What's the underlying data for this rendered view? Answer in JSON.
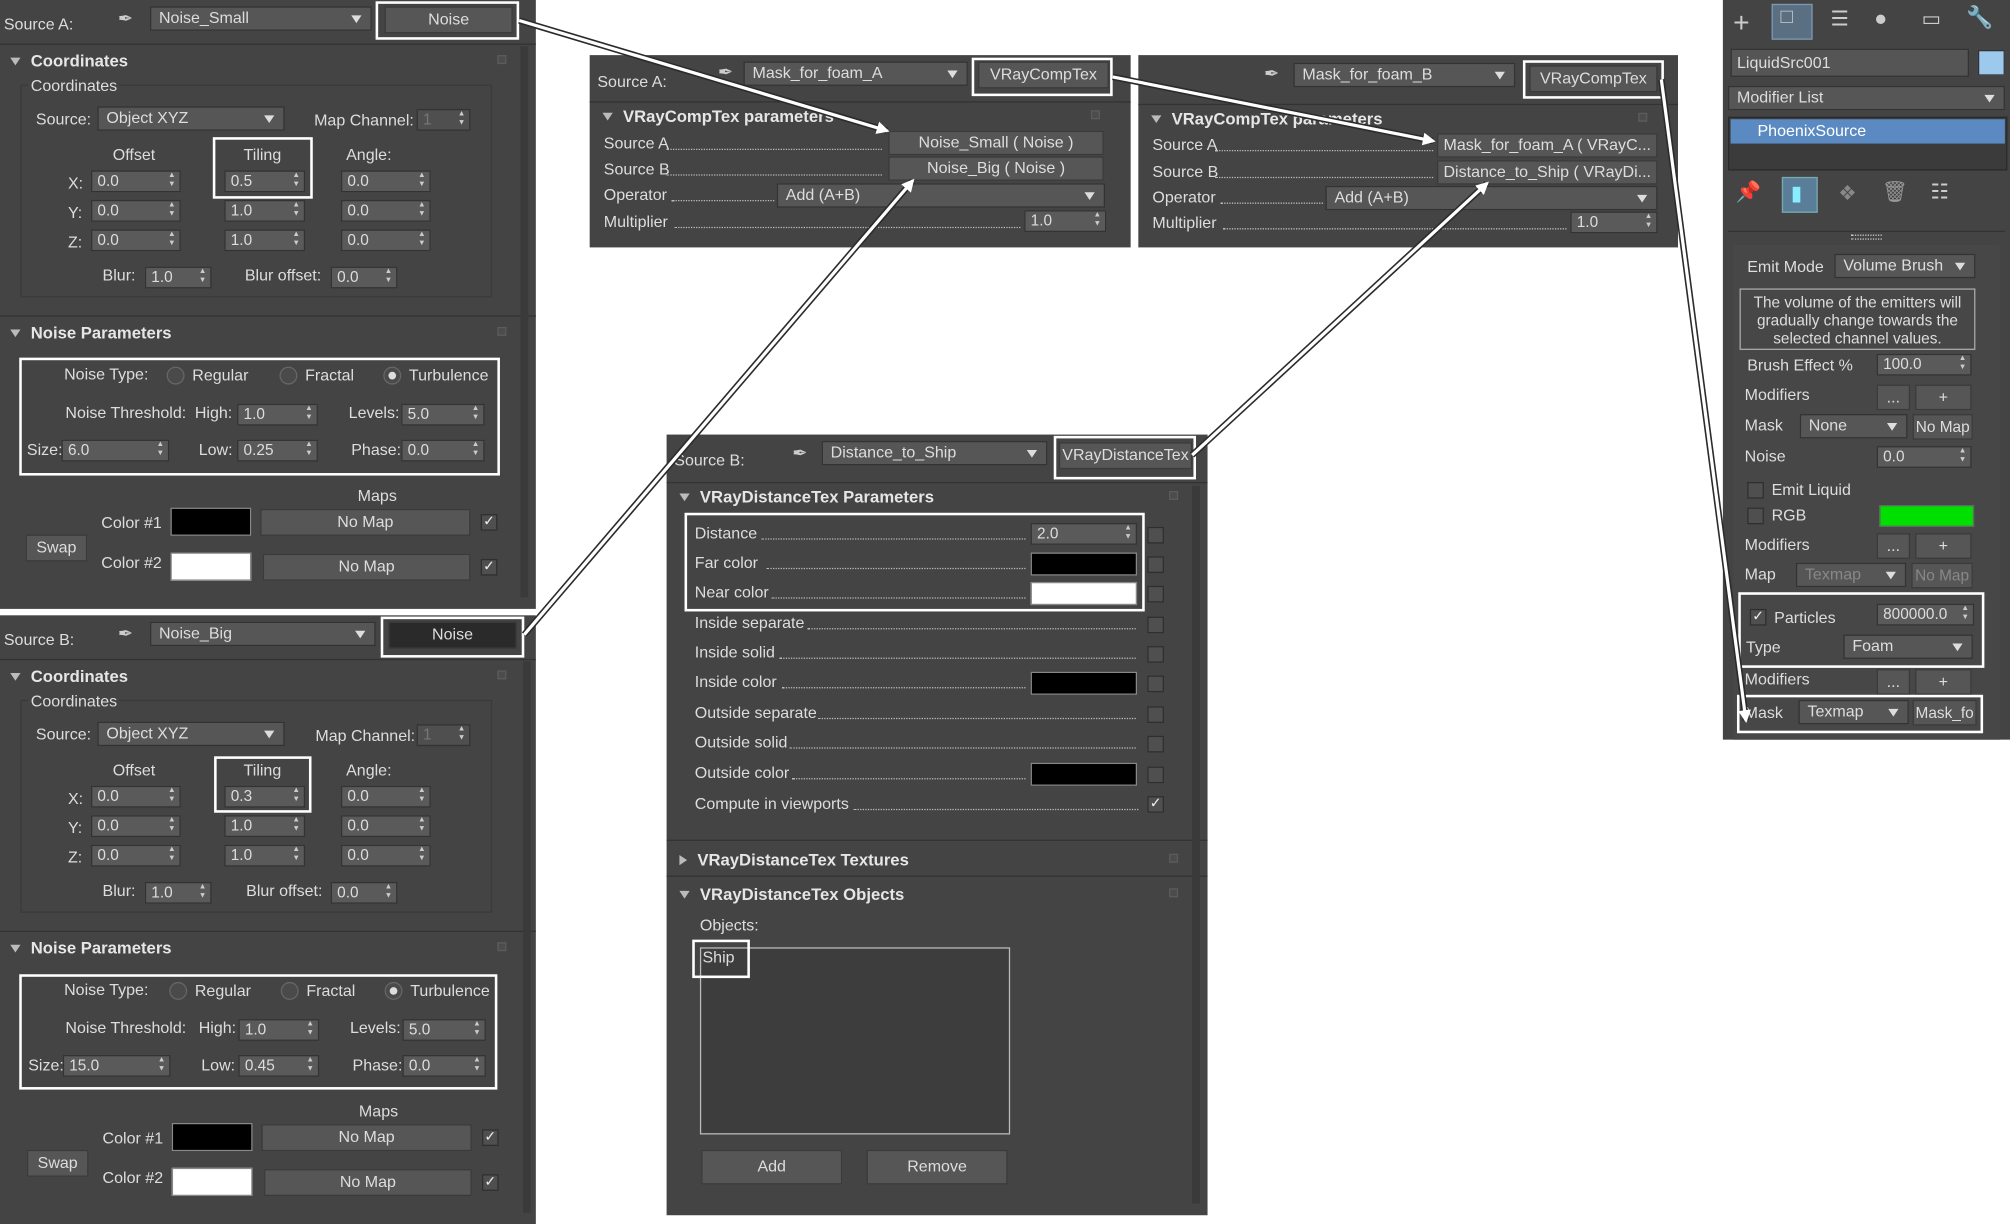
{
  "panelA": {
    "source_label": "Source A:",
    "map_name": "Noise_Small",
    "map_type": "Noise",
    "coords_header": "Coordinates",
    "coords_sub": "Coordinates",
    "source_label2": "Source:",
    "source_value": "Object XYZ",
    "map_channel_label": "Map Channel:",
    "map_channel_value": "1",
    "offset": "Offset",
    "tiling": "Tiling",
    "angle": "Angle:",
    "x": "X:",
    "y": "Y:",
    "z": "Z:",
    "ox": "0.0",
    "oy": "0.0",
    "oz": "0.0",
    "tx": "0.5",
    "ty": "1.0",
    "tz": "1.0",
    "ax": "0.0",
    "ay": "0.0",
    "az": "0.0",
    "blur": "Blur:",
    "blur_value": "1.0",
    "blur_offset": "Blur offset:",
    "blur_offset_value": "0.0",
    "noise_header": "Noise Parameters",
    "noise_type": "Noise Type:",
    "regular": "Regular",
    "fractal": "Fractal",
    "turbulence": "Turbulence",
    "threshold": "Noise Threshold:",
    "high": "High:",
    "high_value": "1.0",
    "levels": "Levels:",
    "levels_value": "5.0",
    "size": "Size:",
    "size_value": "6.0",
    "low": "Low:",
    "low_value": "0.25",
    "phase": "Phase:",
    "phase_value": "0.0",
    "maps": "Maps",
    "color1": "Color #1",
    "color2": "Color #2",
    "no_map": "No Map",
    "swap": "Swap"
  },
  "panelB": {
    "source_label": "Source B:",
    "map_name": "Noise_Big",
    "map_type": "Noise",
    "coords_header": "Coordinates",
    "coords_sub": "Coordinates",
    "source_label2": "Source:",
    "source_value": "Object XYZ",
    "map_channel_label": "Map Channel:",
    "map_channel_value": "1",
    "offset": "Offset",
    "tiling": "Tiling",
    "angle": "Angle:",
    "x": "X:",
    "y": "Y:",
    "z": "Z:",
    "ox": "0.0",
    "oy": "0.0",
    "oz": "0.0",
    "tx": "0.3",
    "ty": "1.0",
    "tz": "1.0",
    "ax": "0.0",
    "ay": "0.0",
    "az": "0.0",
    "blur": "Blur:",
    "blur_value": "1.0",
    "blur_offset": "Blur offset:",
    "blur_offset_value": "0.0",
    "noise_header": "Noise Parameters",
    "noise_type": "Noise Type:",
    "regular": "Regular",
    "fractal": "Fractal",
    "turbulence": "Turbulence",
    "threshold": "Noise Threshold:",
    "high": "High:",
    "high_value": "1.0",
    "levels": "Levels:",
    "levels_value": "5.0",
    "size": "Size:",
    "size_value": "15.0",
    "low": "Low:",
    "low_value": "0.45",
    "phase": "Phase:",
    "phase_value": "0.0",
    "maps": "Maps",
    "color1": "Color #1",
    "color2": "Color #2",
    "no_map": "No Map",
    "swap": "Swap"
  },
  "comp1": {
    "source_label": "Source A:",
    "map_name": "Mask_for_foam_A",
    "map_type": "VRayCompTex",
    "header": "VRayCompTex parameters",
    "source_a": "Source A",
    "source_b": "Source B",
    "operator": "Operator",
    "multiplier": "Multiplier",
    "source_a_value": "Noise_Small  ( Noise )",
    "source_b_value": "Noise_Big  ( Noise )",
    "operator_value": "Add (A+B)",
    "multiplier_value": "1.0"
  },
  "comp2": {
    "map_name": "Mask_for_foam_B",
    "map_type": "VRayCompTex",
    "header": "VRayCompTex parameters",
    "source_a": "Source A",
    "source_b": "Source B",
    "operator": "Operator",
    "multiplier": "Multiplier",
    "source_a_value": "Mask_for_foam_A  ( VRayC...",
    "source_b_value": "Distance_to_Ship  ( VRayDi...",
    "operator_value": "Add (A+B)",
    "multiplier_value": "1.0"
  },
  "dist": {
    "source_label": "Source B:",
    "map_name": "Distance_to_Ship",
    "map_type": "VRayDistanceTex",
    "header": "VRayDistanceTex Parameters",
    "distance": "Distance",
    "distance_value": "2.0",
    "far_color": "Far color",
    "near_color": "Near color",
    "inside_separate": "Inside separate",
    "inside_solid": "Inside solid",
    "inside_color": "Inside color",
    "outside_separate": "Outside separate",
    "outside_solid": "Outside solid",
    "outside_color": "Outside color",
    "compute": "Compute in viewports",
    "textures_header": "VRayDistanceTex Textures",
    "objects_header": "VRayDistanceTex Objects",
    "objects_label": "Objects:",
    "object_item": "Ship",
    "add": "Add",
    "remove": "Remove"
  },
  "modpanel": {
    "object_name": "LiquidSrc001",
    "modifier_list": "Modifier List",
    "stack_item": "PhoenixSource",
    "emit_mode": "Emit Mode",
    "emit_mode_value": "Volume Brush",
    "info": "The volume of the emitters will gradually change towards the selected channel values.",
    "brush_effect": "Brush Effect %",
    "brush_effect_value": "100.0",
    "modifiers": "Modifiers",
    "dots_btn": "...",
    "plus_btn": "+",
    "mask": "Mask",
    "mask_value": "None",
    "no_map": "No Map",
    "noise": "Noise",
    "noise_value": "0.0",
    "emit_liquid": "Emit Liquid",
    "rgb": "RGB",
    "map": "Map",
    "texmap": "Texmap",
    "particles": "Particles",
    "particles_value": "800000.0",
    "type": "Type",
    "type_value": "Foam",
    "mask2_value": "Texmap",
    "mask_map": "Mask_fo",
    "rgb_color": "#00e000"
  }
}
